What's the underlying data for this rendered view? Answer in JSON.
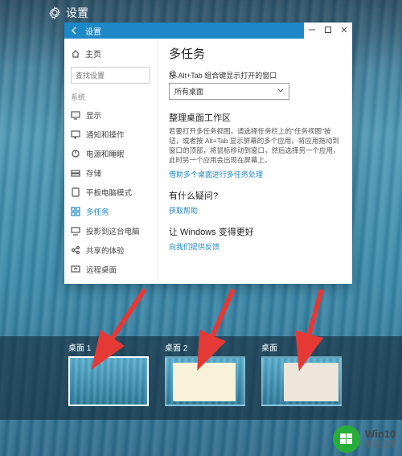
{
  "desktop_title": {
    "label": "设置"
  },
  "window": {
    "title": "设置",
    "home_label": "主页",
    "search_placeholder": "查找设置",
    "group_label": "系统"
  },
  "nav": [
    {
      "key": "display",
      "label": "显示"
    },
    {
      "key": "notifications",
      "label": "通知和操作"
    },
    {
      "key": "power",
      "label": "电源和睡眠"
    },
    {
      "key": "storage",
      "label": "存储"
    },
    {
      "key": "tablet",
      "label": "平板电脑模式"
    },
    {
      "key": "multitask",
      "label": "多任务"
    },
    {
      "key": "project",
      "label": "投影到这台电脑"
    },
    {
      "key": "shared",
      "label": "共享的体验"
    },
    {
      "key": "remote",
      "label": "远程桌面"
    }
  ],
  "content": {
    "title": "多任务",
    "alt_tab_label": "按 Alt+Tab 组合键显示打开的窗口",
    "alt_tab_value": "所有桌面",
    "arrange": {
      "title": "整理桌面工作区",
      "desc": "若要打开多任务视图，请选择任务栏上的\"任务视图\"按钮，或者按 Alt+Tab 显示屏幕的多个应用。将应用拖动到窗口的顶部，将鼠标移动到窗口，然后选择另一个应用，此时另一个应用会出现在屏幕上。",
      "link": "借助多个桌面进行多任务处理"
    },
    "question": {
      "title": "有什么疑问?",
      "link": "获取帮助"
    },
    "improve": {
      "title": "让 Windows 变得更好",
      "link": "向我们提供反馈"
    }
  },
  "desks": [
    {
      "label": "桌面 1"
    },
    {
      "label": "桌面 2"
    },
    {
      "label": "桌面"
    }
  ],
  "watermark": {
    "big": "Win10",
    "small": "系统之家"
  }
}
